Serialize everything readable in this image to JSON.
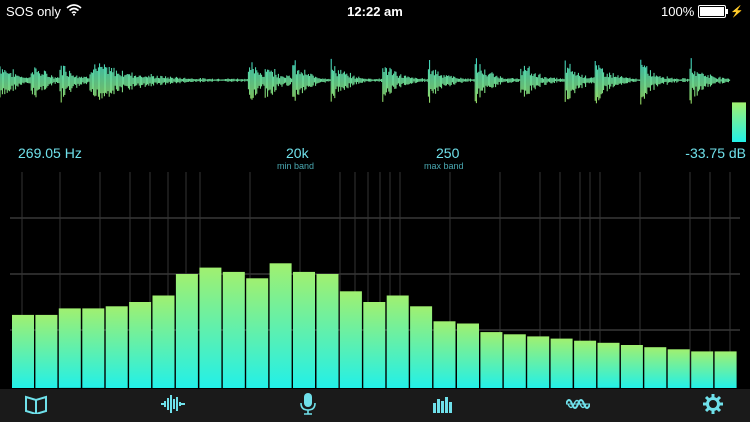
{
  "status_bar": {
    "carrier": "SOS only",
    "time": "12:22 am",
    "battery_text": "100%",
    "battery_level": 1.0,
    "icons": [
      "wifi-icon",
      "battery-icon",
      "charging-bolt-icon"
    ]
  },
  "readouts": {
    "frequency": "269.05 Hz",
    "min_band_value": "20k",
    "min_band_label": "min band",
    "max_band_value": "250",
    "max_band_label": "max band",
    "level": "-33.75 dB"
  },
  "level_meter": {
    "level": 0.55
  },
  "spectrum": {
    "bar_levels": [
      0.34,
      0.34,
      0.37,
      0.37,
      0.38,
      0.4,
      0.43,
      0.53,
      0.56,
      0.54,
      0.51,
      0.58,
      0.54,
      0.53,
      0.45,
      0.4,
      0.43,
      0.38,
      0.31,
      0.3,
      0.26,
      0.25,
      0.24,
      0.23,
      0.22,
      0.21,
      0.2,
      0.19,
      0.18,
      0.17,
      0.17
    ]
  },
  "colors": {
    "accent": "#6fe0ea",
    "bar_top": "#a0f070",
    "bar_bottom": "#22f0e8",
    "wave": "#3fe8d8"
  },
  "tab_bar": {
    "tabs": [
      {
        "icon": "book-icon"
      },
      {
        "icon": "waveform-icon"
      },
      {
        "icon": "microphone-icon"
      },
      {
        "icon": "spectrum-bars-icon"
      },
      {
        "icon": "oscilloscope-icon"
      },
      {
        "icon": "gear-icon"
      }
    ]
  }
}
